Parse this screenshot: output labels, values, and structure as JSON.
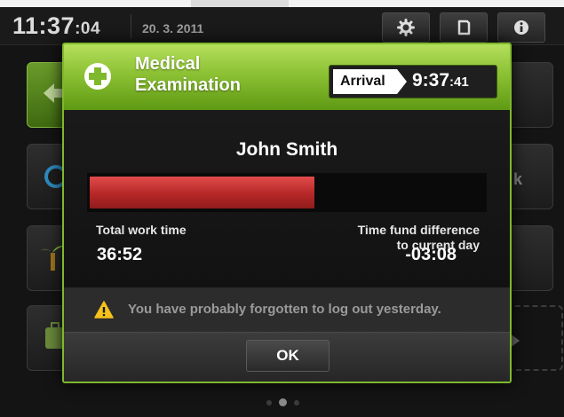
{
  "status_bar": {
    "clock": "11:37",
    "clock_seconds": ":04",
    "date": "20. 3. 2011",
    "buttons": [
      "gear-icon",
      "card-icon",
      "info-icon"
    ]
  },
  "background": {
    "right_text": "k"
  },
  "dialog": {
    "title_line1": "Medical",
    "title_line2": "Examination",
    "arrival_label": "Arrival",
    "arrival_time": "9:37",
    "arrival_seconds": ":41",
    "person_name": "John Smith",
    "work_time": "36:52",
    "time_fund_diff": "-03:08",
    "work_progress": 0.57,
    "total_work_label": "Total work time",
    "diff_label_line1": "Time fund difference",
    "diff_label_line2": "to current day",
    "warning_text": "You have probably forgotten to log out yesterday.",
    "ok_label": "OK"
  },
  "pager": {
    "pages": 3,
    "current": 2
  },
  "colors": {
    "accent_green": "#8cc133",
    "bar_red": "#b52727",
    "warning_yellow": "#f3c21b"
  }
}
